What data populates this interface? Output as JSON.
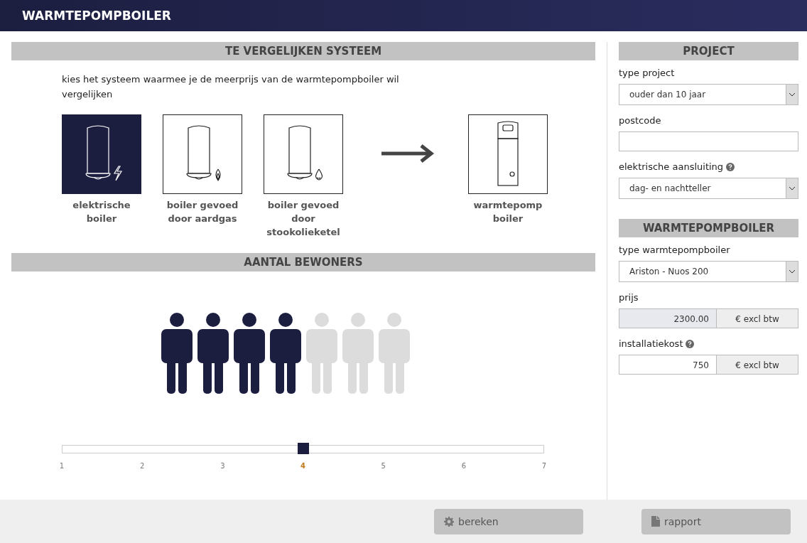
{
  "header": {
    "title": "WARMTEPOMPBOILER"
  },
  "compare": {
    "title": "TE VERGELIJKEN SYSTEEM",
    "intro": "kies het systeem waarmee je de meerprijs van de warmtepompboiler wil vergelijken",
    "systems": [
      {
        "kind": "electric",
        "label": "elektrische boiler",
        "selected": true
      },
      {
        "kind": "gas",
        "label": "boiler gevoed door aardgas",
        "selected": false
      },
      {
        "kind": "oil",
        "label": "boiler gevoed door stookolieketel",
        "selected": false
      }
    ],
    "target": {
      "label": "warmtepomp boiler"
    }
  },
  "residents": {
    "title": "AANTAL BEWONERS",
    "people": [
      {
        "filled": true
      },
      {
        "filled": true
      },
      {
        "filled": true
      },
      {
        "filled": true
      },
      {
        "filled": false
      },
      {
        "filled": false
      },
      {
        "filled": false
      }
    ],
    "ticks": [
      {
        "label": "1",
        "selected": false
      },
      {
        "label": "2",
        "selected": false
      },
      {
        "label": "3",
        "selected": false
      },
      {
        "label": "4",
        "selected": true
      },
      {
        "label": "5",
        "selected": false
      },
      {
        "label": "6",
        "selected": false
      },
      {
        "label": "7",
        "selected": false
      }
    ]
  },
  "project": {
    "title": "PROJECT",
    "fields": [
      {
        "kind": "select",
        "label": "type project",
        "value": "ouder dan 10 jaar",
        "help": false
      },
      {
        "kind": "text",
        "label": "postcode",
        "help": false
      },
      {
        "kind": "select",
        "label": "elektrische aansluiting",
        "value": "dag- en nachtteller",
        "help": true
      }
    ]
  },
  "heatpump": {
    "title": "WARMTEPOMPBOILER",
    "fields": [
      {
        "kind": "select",
        "label": "type warmtepompboiler",
        "value": "Ariston - Nuos 200",
        "help": false
      },
      {
        "kind": "money",
        "label": "prijs",
        "value": "2300.00",
        "unit": "€ excl btw",
        "help": false,
        "disabled": true
      },
      {
        "kind": "money",
        "label": "installatiekost",
        "value": "750",
        "unit": "€ excl btw",
        "help": true,
        "disabled": false
      }
    ]
  },
  "footer": {
    "buttons": [
      {
        "kind": "calc",
        "label": "bereken"
      },
      {
        "kind": "report",
        "label": "rapport"
      }
    ]
  }
}
